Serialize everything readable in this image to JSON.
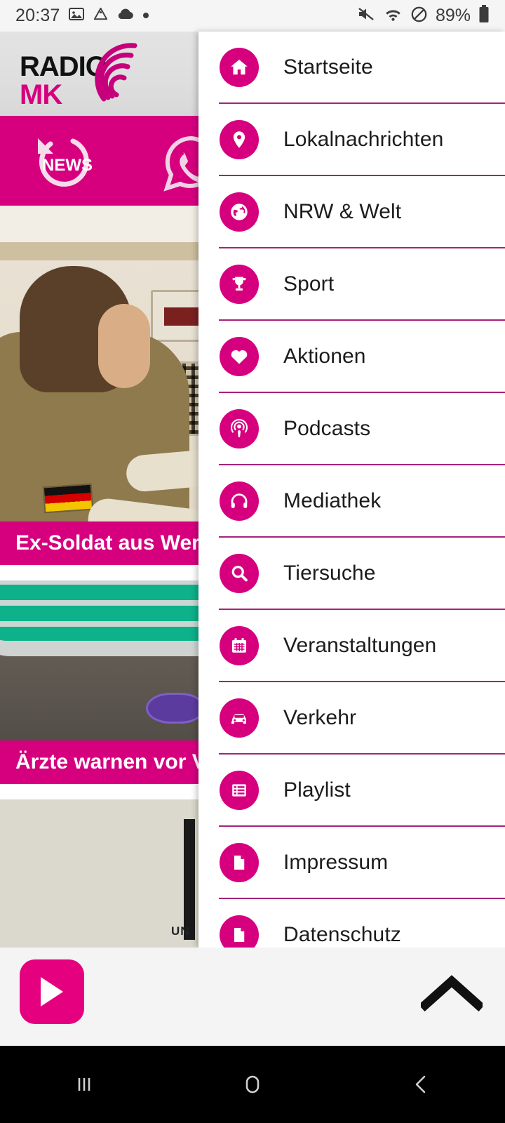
{
  "status_bar": {
    "time": "20:37",
    "battery_percent": "89%",
    "left_icons": [
      "image-icon",
      "drive-icon",
      "cloud-icon",
      "dot-icon"
    ],
    "right_icons": [
      "mute-icon",
      "wifi-icon",
      "dnd-icon",
      "battery-icon"
    ]
  },
  "header": {
    "logo_line1": "RADIO",
    "logo_line2": "MK",
    "logo_color": "#d6007f",
    "toolbar": {
      "news_label": "NEWS",
      "news_icon": "news-refresh-icon",
      "whatsapp_icon": "whatsapp-icon",
      "background": "#d6007f"
    }
  },
  "news_cards": [
    {
      "title": "Ex-Soldat aus Werd",
      "image": "soldier-in-uniform-photo"
    },
    {
      "title": "Ärzte warnen vor Ve",
      "image": "syringes-tray-photo"
    },
    {
      "title": "",
      "image": "uni-building-photo",
      "overlay_text": "UN"
    }
  ],
  "drawer": {
    "accent": "#d6007f",
    "divider_color": "#a6217a",
    "items": [
      {
        "label": "Startseite",
        "icon": "home-icon"
      },
      {
        "label": "Lokalnachrichten",
        "icon": "map-pin-icon"
      },
      {
        "label": "NRW & Welt",
        "icon": "globe-icon"
      },
      {
        "label": "Sport",
        "icon": "trophy-icon"
      },
      {
        "label": "Aktionen",
        "icon": "heart-icon"
      },
      {
        "label": "Podcasts",
        "icon": "podcast-icon"
      },
      {
        "label": "Mediathek",
        "icon": "headphones-icon"
      },
      {
        "label": "Tiersuche",
        "icon": "search-icon"
      },
      {
        "label": "Veranstaltungen",
        "icon": "calendar-icon"
      },
      {
        "label": "Verkehr",
        "icon": "car-icon"
      },
      {
        "label": "Playlist",
        "icon": "list-icon"
      },
      {
        "label": "Impressum",
        "icon": "document-icon"
      },
      {
        "label": "Datenschutz",
        "icon": "document-icon"
      }
    ]
  },
  "player": {
    "play_icon": "play-icon",
    "expand_icon": "chevron-up-icon",
    "background": "#f4f4f4",
    "play_button_color": "#e4007f"
  },
  "nav_bar": {
    "recents_icon": "recents-icon",
    "home_icon": "home-square-icon",
    "back_icon": "back-chevron-icon"
  }
}
